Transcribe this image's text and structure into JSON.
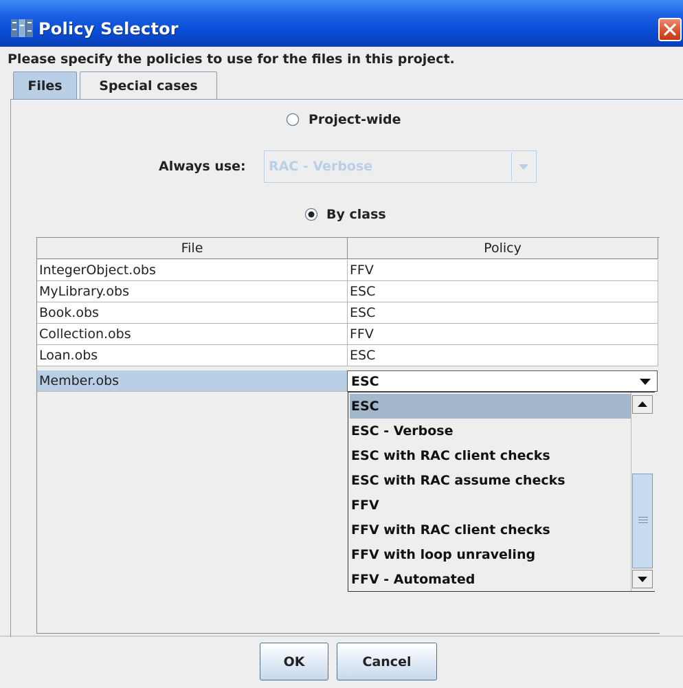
{
  "window": {
    "title": "Policy Selector",
    "icon": "java-app-icon",
    "close_icon": "close-icon"
  },
  "instruction": "Please specify the policies to use for the files in this project.",
  "tabs": [
    {
      "label": "Files",
      "active": true
    },
    {
      "label": "Special cases",
      "active": false
    }
  ],
  "project_wide": {
    "label": "Project-wide",
    "selected": false
  },
  "always_use": {
    "label": "Always use:",
    "value": "RAC - Verbose",
    "enabled": false
  },
  "by_class": {
    "label": "By class",
    "selected": true
  },
  "table": {
    "columns": [
      "File",
      "Policy"
    ],
    "rows": [
      {
        "file": "IntegerObject.obs",
        "policy": "FFV"
      },
      {
        "file": "MyLibrary.obs",
        "policy": "ESC"
      },
      {
        "file": "Book.obs",
        "policy": "ESC"
      },
      {
        "file": "Collection.obs",
        "policy": "FFV"
      },
      {
        "file": "Loan.obs",
        "policy": "ESC"
      },
      {
        "file": "Member.obs",
        "policy": "ESC",
        "selected": true,
        "editing": true
      }
    ]
  },
  "policy_dropdown": {
    "selected": "ESC",
    "options": [
      "ESC",
      "ESC - Verbose",
      "ESC with RAC client checks",
      "ESC with RAC assume checks",
      "FFV",
      "FFV with RAC client checks",
      "FFV with loop unraveling",
      "FFV - Automated"
    ]
  },
  "buttons": {
    "ok": "OK",
    "cancel": "Cancel"
  },
  "colors": {
    "titlebar": "#0a4ed8",
    "selection": "#b8cfe5",
    "list_selection": "#a3b8cc",
    "close": "#d9502d"
  }
}
